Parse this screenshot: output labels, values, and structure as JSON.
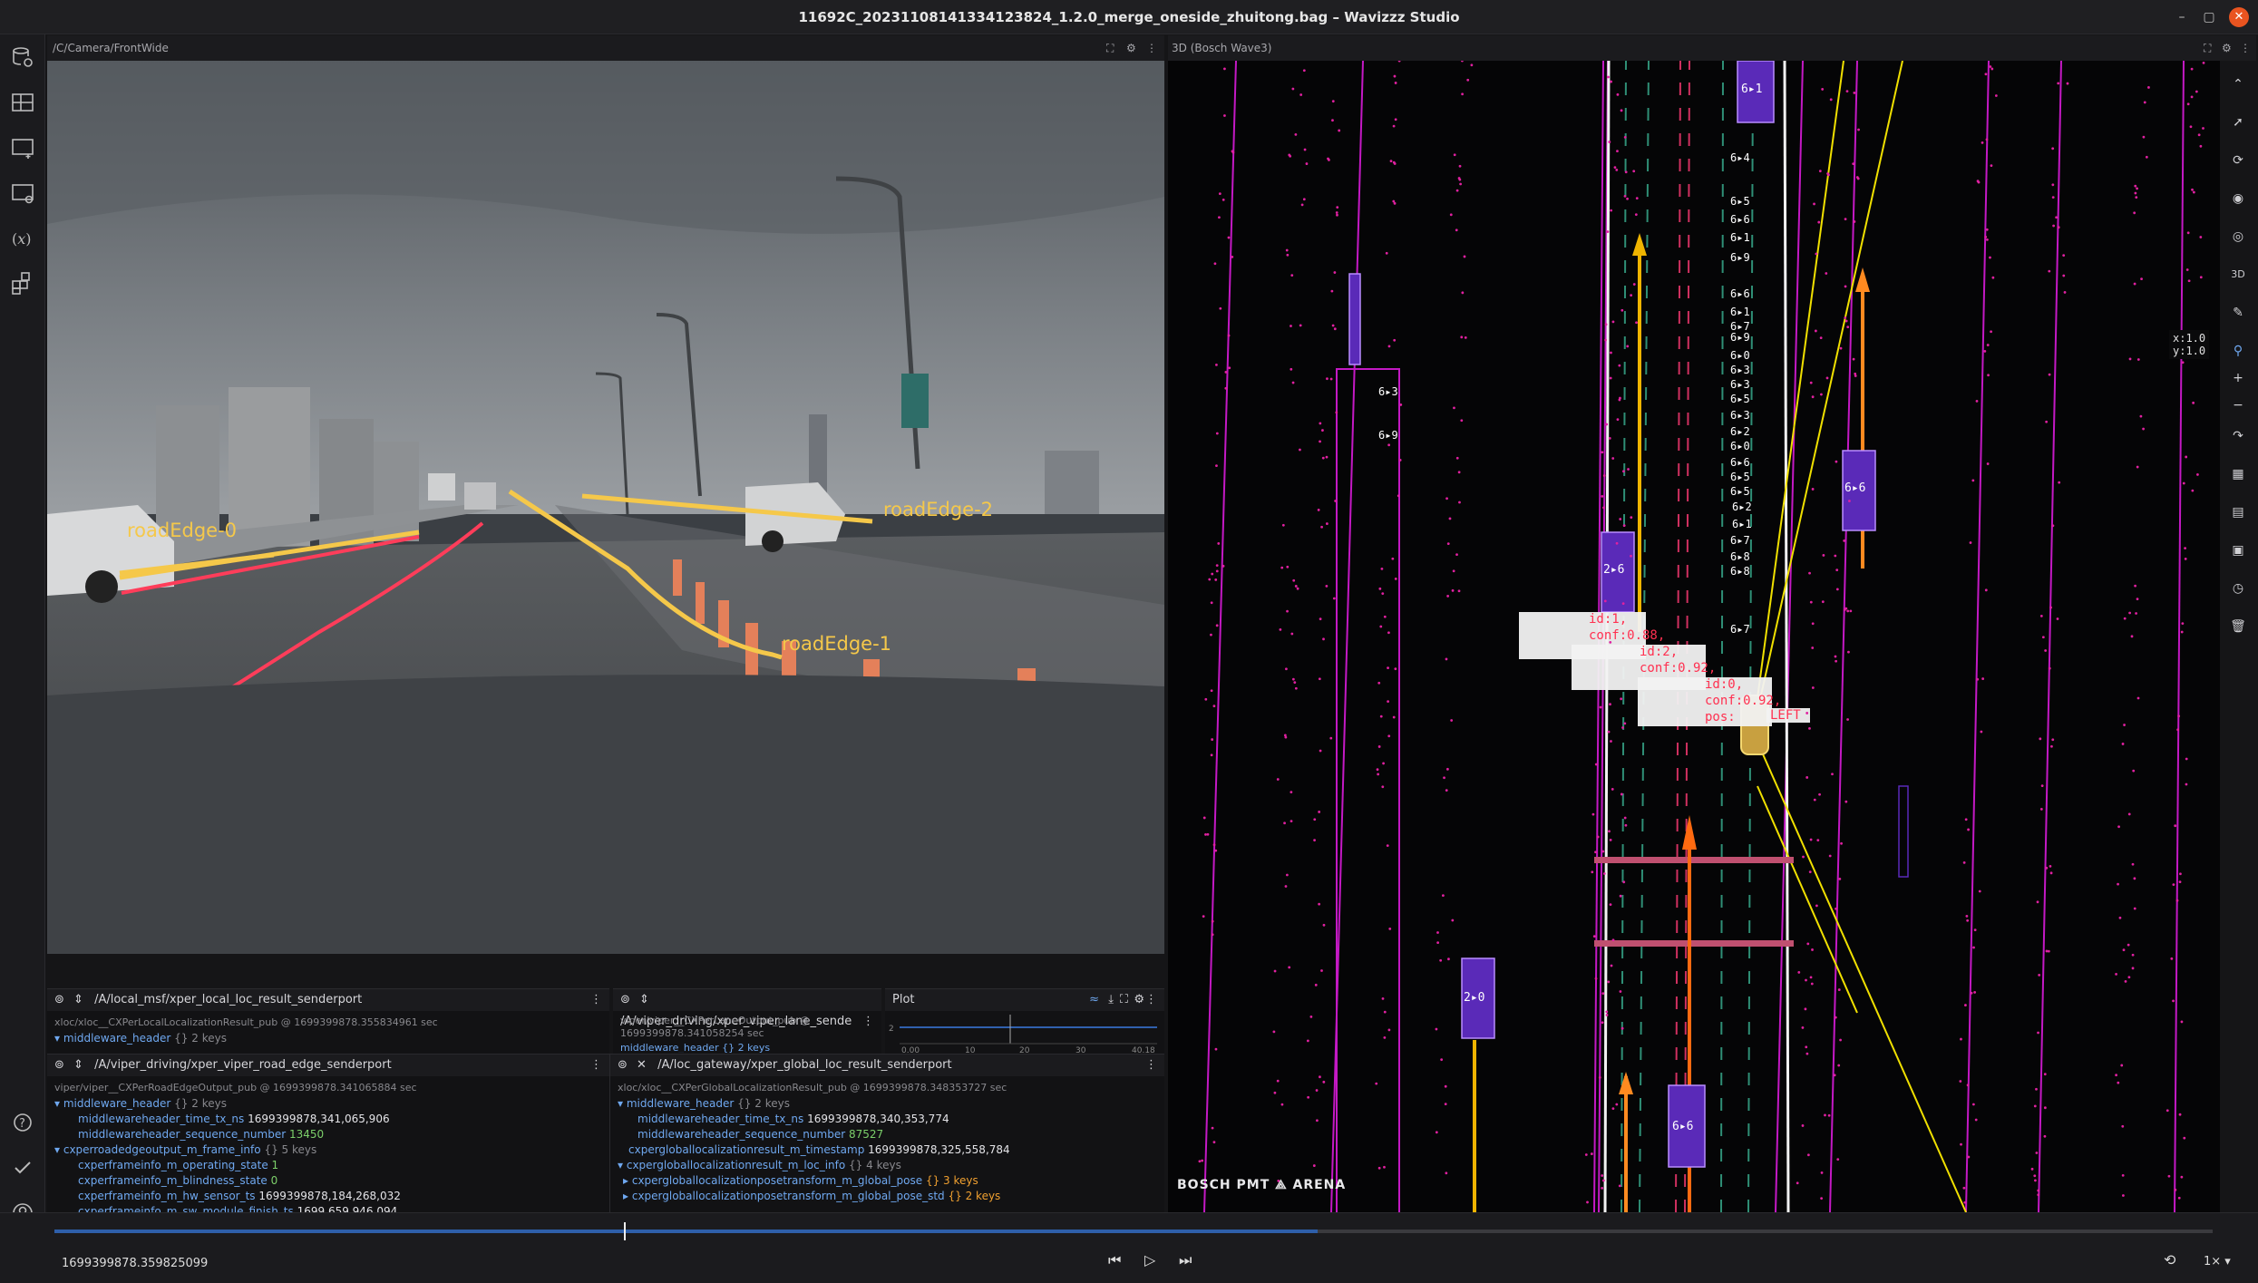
{
  "window": {
    "title": "11692C_20231108141334123824_1.2.0_merge_oneside_zhuitong.bag – Wavizzz Studio",
    "min": "–",
    "max": "▢",
    "close": "✕"
  },
  "camera_panel": {
    "topic": "/C/Camera/FrontWide",
    "labels": {
      "edge0": "roadEdge-0",
      "edge1": "roadEdge-1",
      "edge2": "roadEdge-2"
    }
  },
  "scene_panel": {
    "title": "3D (Bosch Wave3)",
    "coords": {
      "x": "x:1.0",
      "y": "y:1.0"
    },
    "brand": "BOSCH PMT ⟁ ARENA",
    "id_tags": [
      "id:1,",
      "conf:0.88,",
      "id:2,",
      "conf:0.92,",
      "id:0,",
      "conf:0.92,",
      "pos:",
      "LEFT"
    ],
    "index_labels": [
      "6▸4",
      "6▸5",
      "6▸6",
      "6▸1",
      "6▸9",
      "6▸6",
      "6▸1",
      "6▸7",
      "6▸9",
      "6▸0",
      "6▸3",
      "6▸3",
      "6▸5",
      "6▸3",
      "6▸2",
      "6▸0",
      "6▸6",
      "6▸5",
      "6▸5",
      "6▸2",
      "6▸1",
      "6▸7",
      "6▸8",
      "6▸8",
      "6▸7",
      "6▸3",
      "6▸9"
    ],
    "vehicle_labels": [
      "2▸6",
      "6▸6",
      "2▸0",
      "6▸6",
      "6▸1"
    ]
  },
  "panels": {
    "p1": {
      "topic": "/A/local_msf/xper_local_loc_result_senderport",
      "subtitle": "xloc/xloc__CXPerLocalLocalizationResult_pub @ 1699399878.355834961 sec",
      "rows": [
        {
          "k": "middleware_header",
          "t": "{} 2 keys"
        }
      ]
    },
    "p2": {
      "topic": "/A/viper_driving/xper_viper_lane_sende",
      "subtitle": "viper/viper__CXPerLaneOutput_pub @",
      "subtitle2": "1699399878.341058254 sec",
      "cut": "middleware_header   {} 2 keys"
    },
    "plot": {
      "title": "Plot",
      "ticks": [
        "0.00",
        "10",
        "20",
        "30",
        "40.18"
      ],
      "yt": "2"
    },
    "p3": {
      "topic": "/A/viper_driving/xper_viper_road_edge_senderport",
      "subtitle": "viper/viper__CXPerRoadEdgeOutput_pub @ 1699399878.341065884 sec",
      "rows": [
        {
          "k": "middleware_header",
          "t": "{} 2 keys"
        },
        {
          "k": "middlewareheader_time_tx_ns",
          "v": "1699399878,341,065,906"
        },
        {
          "k": "middlewareheader_sequence_number",
          "v": "13450"
        },
        {
          "k": "cxperroadedgeoutput_m_frame_info",
          "t": "{} 5 keys"
        },
        {
          "k": "cxperframeinfo_m_operating_state",
          "v": "1"
        },
        {
          "k": "cxperframeinfo_m_blindness_state",
          "v": "0"
        },
        {
          "k": "cxperframeinfo_m_hw_sensor_ts",
          "v": "1699399878,184,268,032"
        },
        {
          "k": "cxperframeinfo_m_sw_module_finish_ts",
          "v": "1699,659,946,094"
        }
      ]
    },
    "p4": {
      "topic": "/A/loc_gateway/xper_global_loc_result_senderport",
      "subtitle": "xloc/xloc__CXPerGlobalLocalizationResult_pub @ 1699399878.348353727 sec",
      "rows": [
        {
          "k": "middleware_header",
          "t": "{} 2 keys"
        },
        {
          "k": "middlewareheader_time_tx_ns",
          "v": "1699399878,340,353,774"
        },
        {
          "k": "middlewareheader_sequence_number",
          "v": "87527"
        },
        {
          "k": "cxpergloballocalizationresult_m_timestamp",
          "v": "1699399878,325,558,784"
        },
        {
          "k": "cxpergloballocalizationresult_m_loc_info",
          "t": "{} 4 keys"
        },
        {
          "k": "cxpergloballocalizationposetransform_m_global_pose",
          "t": "{} 3 keys"
        },
        {
          "k": "cxpergloballocalizationposetransform_m_global_pose_std",
          "t": "{} 2 keys"
        }
      ]
    }
  },
  "playback": {
    "timestamp": "1699399878.359825099",
    "speed": "1×",
    "progress": 0.44
  },
  "colors": {
    "accent": "#e95420",
    "edgeYellow": "#f5c84a",
    "edgeRed": "#ff3d5a",
    "magenta": "#d01ad0"
  }
}
